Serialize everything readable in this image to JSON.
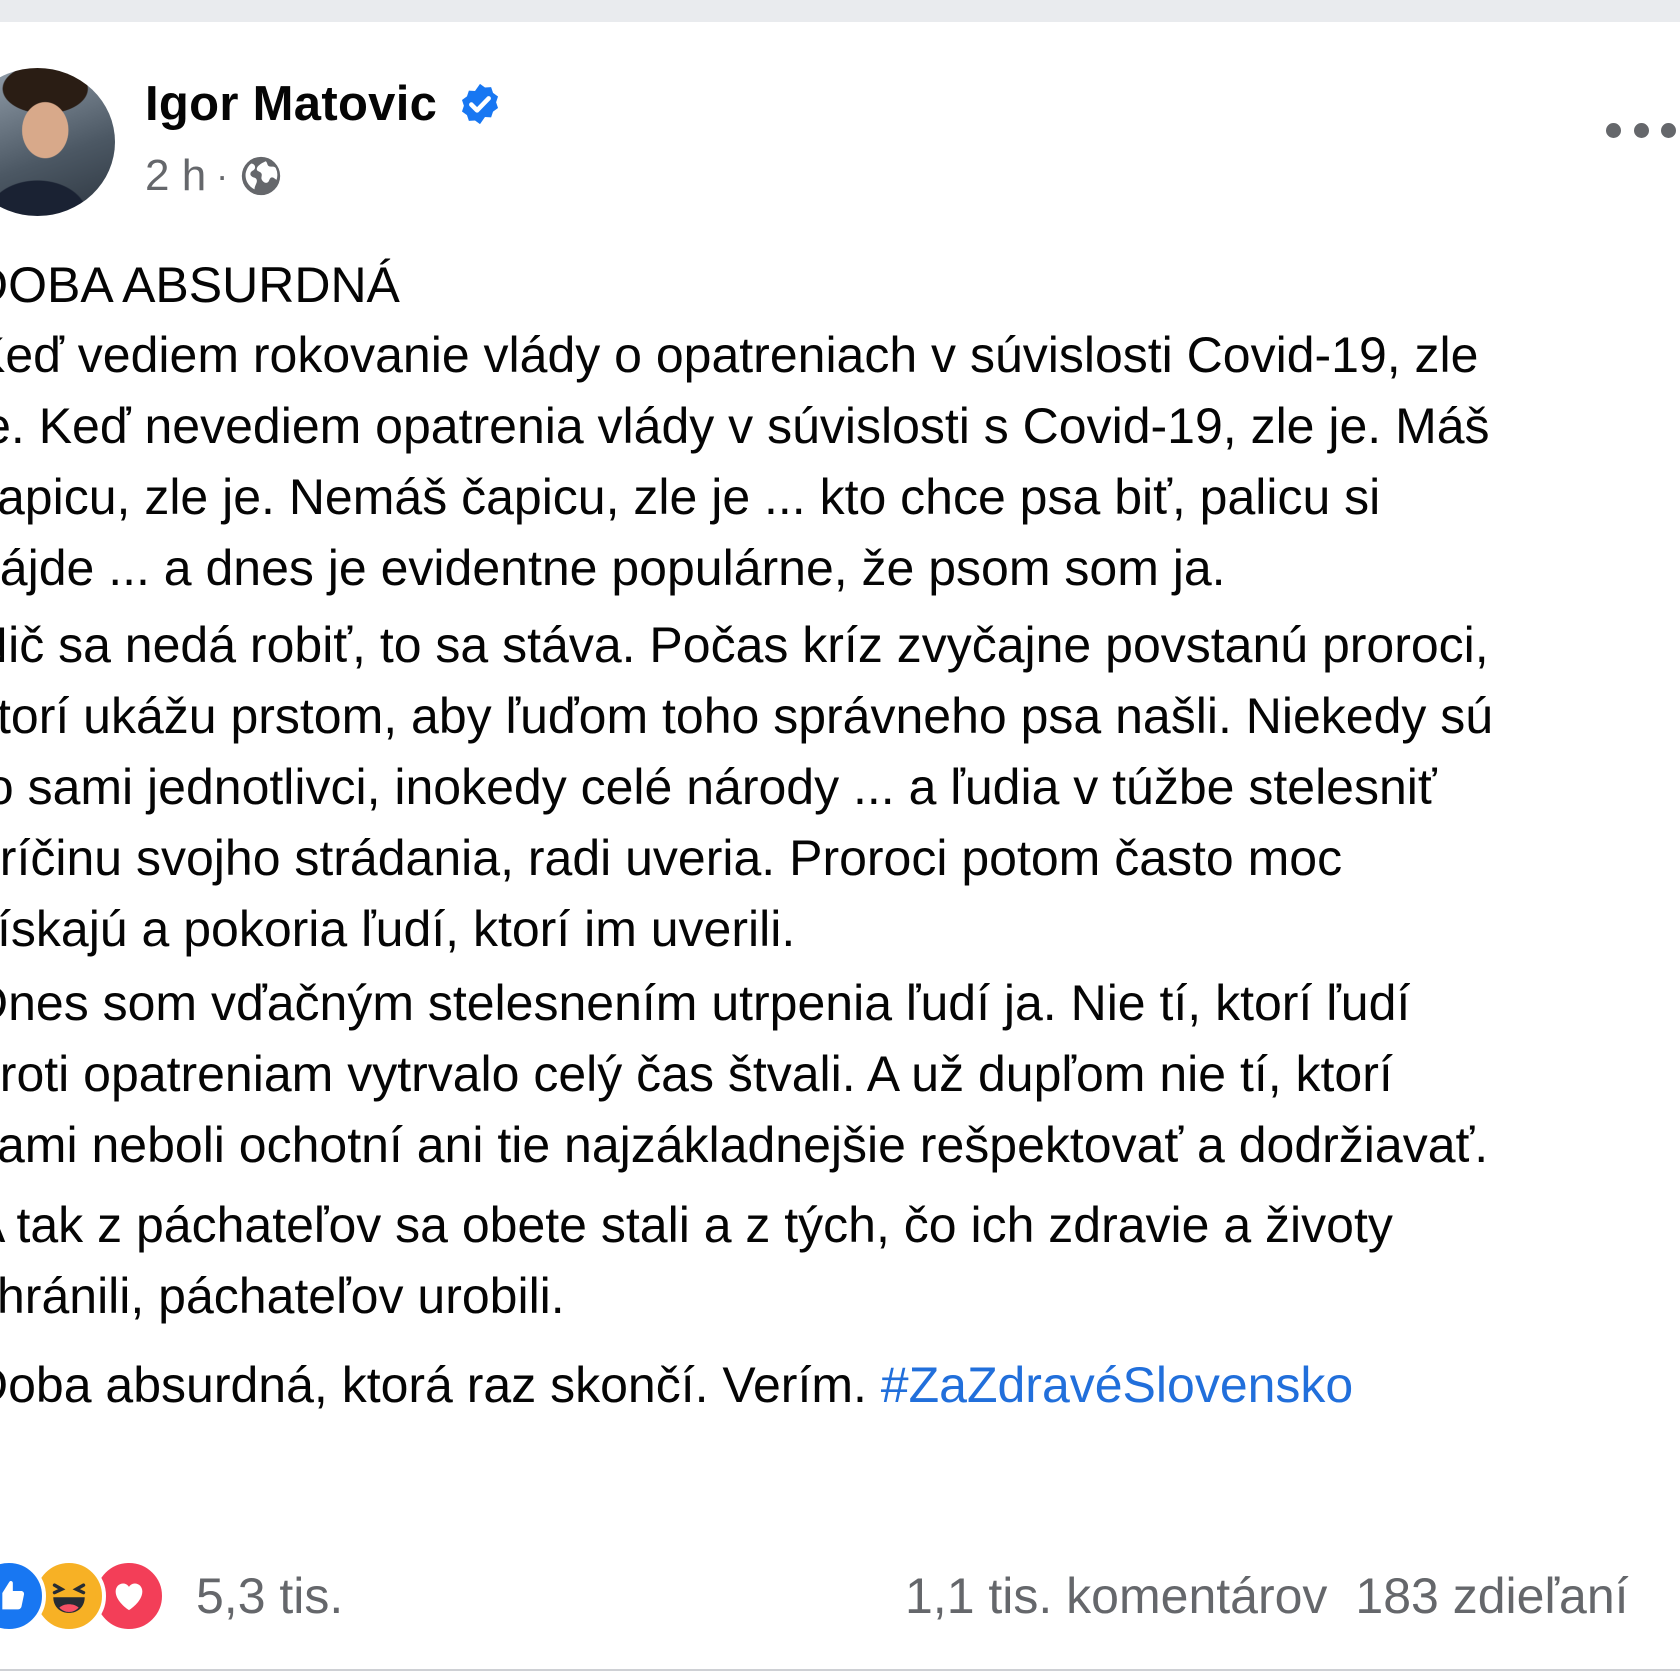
{
  "author": {
    "name": "Igor Matovic",
    "verified_icon": "verified-badge-icon",
    "time": "2 h",
    "separator": "·",
    "audience_icon": "globe-icon"
  },
  "post": {
    "title": "DOBA ABSURDNÁ",
    "paragraphs": [
      [
        "Keď vediem rokovanie vlády o opatreniach v súvislosti Covid-19, zle",
        "je. Keď nevediem opatrenia vlády v súvislosti s Covid-19, zle je. Máš",
        "čapicu, zle je. Nemáš čapicu, zle je ... kto chce psa biť, palicu si",
        "nájde ... a dnes je evidentne populárne, že psom som ja."
      ],
      [
        "Nič sa nedá robiť, to sa stáva. Počas kríz zvyčajne povstanú proroci,",
        "ktorí ukážu prstom, aby ľuďom toho správneho psa našli. Niekedy sú",
        "to sami jednotlivci, inokedy celé národy ... a ľudia v túžbe stelesniť",
        "príčinu svojho strádania, radi uveria. Proroci potom často moc",
        "získajú a pokoria ľudí, ktorí im uverili."
      ],
      [
        "Dnes som vďačným stelesnením utrpenia ľudí ja. Nie tí, ktorí ľudí",
        "proti opatreniam vytrvalo celý čas štvali. A už dupľom nie tí, ktorí",
        "sami neboli ochotní ani tie najzákladnejšie rešpektovať a dodržiavať."
      ],
      [
        "A tak z páchateľov sa obete stali a z tých, čo ich zdravie a životy",
        "chránili, páchateľov urobili."
      ]
    ],
    "closing": "Doba absurdná, ktorá raz skončí. Verím.",
    "hashtag": "#ZaZdravéSlovensko"
  },
  "footer": {
    "reaction_icons": [
      "like-icon",
      "haha-icon",
      "love-icon"
    ],
    "reaction_count": "5,3 tis.",
    "comments": "1,1 tis. komentárov",
    "shares": "183 zdieľaní"
  },
  "colors": {
    "text": "#050505",
    "secondary": "#65676b",
    "link": "#216fdb",
    "verified": "#1877f2"
  }
}
